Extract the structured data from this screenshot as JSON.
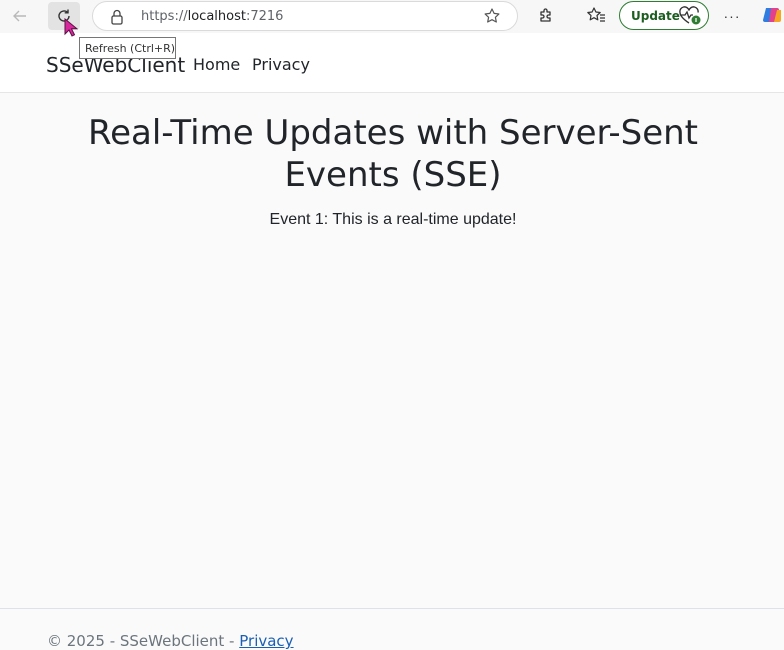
{
  "browser": {
    "url_scheme": "https://",
    "url_host": "localhost",
    "url_port": ":7216",
    "update_label": "Update",
    "more_label": "···",
    "refresh_tooltip": "Refresh (Ctrl+R)",
    "icons": [
      "back-icon",
      "refresh-icon",
      "lock-icon",
      "star-icon",
      "extensions-icon",
      "favorites-icon",
      "heart-pulse-icon",
      "more-icon",
      "copilot-icon"
    ]
  },
  "navbar": {
    "brand": "SSeWebClient",
    "links": [
      "Home",
      "Privacy"
    ]
  },
  "main": {
    "title": "Real-Time Updates with Server-Sent Events (SSE)",
    "events": [
      "Event 1: This is a real-time update!"
    ]
  },
  "footer": {
    "text": "© 2025 - SSeWebClient - ",
    "link": "Privacy"
  },
  "colors": {
    "update_border": "#2e7d32",
    "footer_link": "#1a5fb4",
    "page_bg": "#fafafa"
  }
}
